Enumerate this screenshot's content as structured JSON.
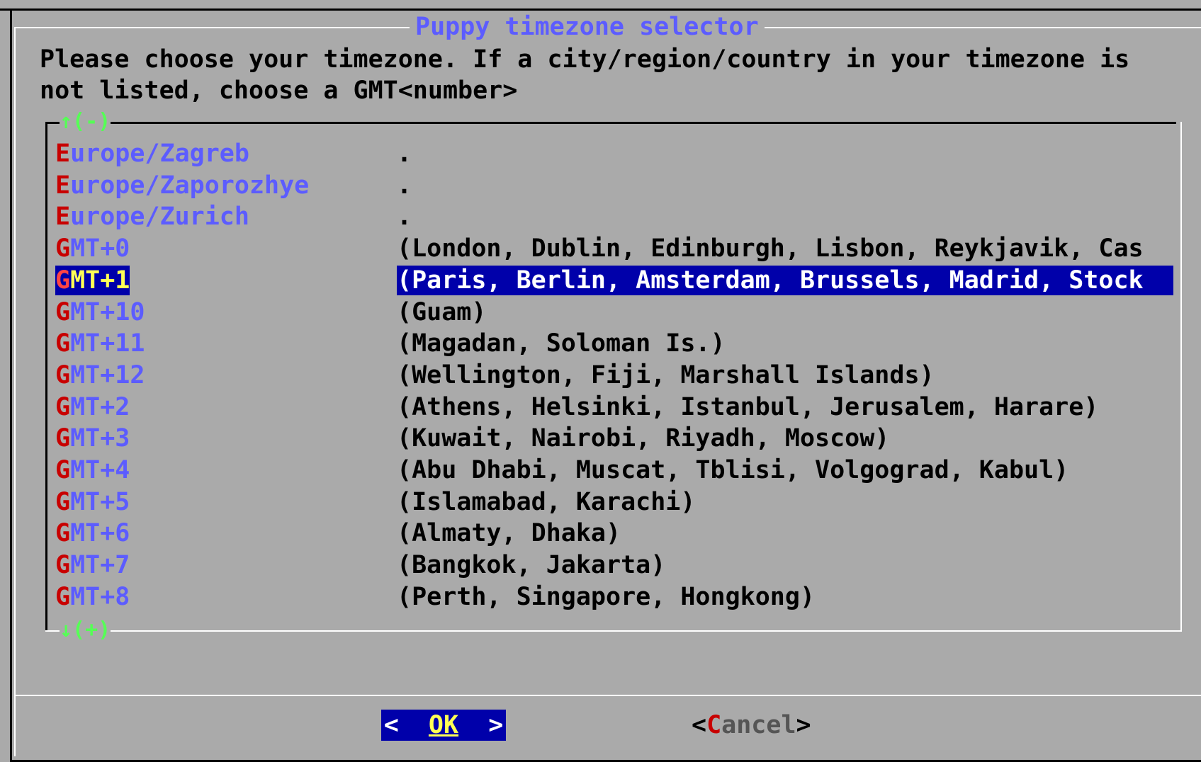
{
  "dialog": {
    "title": "Puppy timezone selector",
    "prompt_line1": "Please choose your timezone. If a city/region/country in your timezone is",
    "prompt_line2": "not listed, choose a GMT<number>"
  },
  "list": {
    "scroll_up_label": "↑(-)",
    "scroll_down_label": "↓(+)",
    "items": [
      {
        "hotkey": "E",
        "rest": "urope/Zagreb",
        "desc": "."
      },
      {
        "hotkey": "E",
        "rest": "urope/Zaporozhye",
        "desc": "."
      },
      {
        "hotkey": "E",
        "rest": "urope/Zurich",
        "desc": "."
      },
      {
        "hotkey": "G",
        "rest": "MT+0",
        "desc": "(London, Dublin, Edinburgh, Lisbon, Reykjavik, Cas"
      },
      {
        "hotkey": "G",
        "rest": "MT+1",
        "desc": "(Paris, Berlin, Amsterdam, Brussels, Madrid, Stock"
      },
      {
        "hotkey": "G",
        "rest": "MT+10",
        "desc": "(Guam)"
      },
      {
        "hotkey": "G",
        "rest": "MT+11",
        "desc": "(Magadan, Soloman Is.)"
      },
      {
        "hotkey": "G",
        "rest": "MT+12",
        "desc": "(Wellington, Fiji, Marshall Islands)"
      },
      {
        "hotkey": "G",
        "rest": "MT+2",
        "desc": "(Athens, Helsinki, Istanbul, Jerusalem, Harare)"
      },
      {
        "hotkey": "G",
        "rest": "MT+3",
        "desc": "(Kuwait, Nairobi, Riyadh, Moscow)"
      },
      {
        "hotkey": "G",
        "rest": "MT+4",
        "desc": "(Abu Dhabi, Muscat, Tblisi, Volgograd, Kabul)"
      },
      {
        "hotkey": "G",
        "rest": "MT+5",
        "desc": "(Islamabad, Karachi)"
      },
      {
        "hotkey": "G",
        "rest": "MT+6",
        "desc": "(Almaty, Dhaka)"
      },
      {
        "hotkey": "G",
        "rest": "MT+7",
        "desc": "(Bangkok, Jakarta)"
      },
      {
        "hotkey": "G",
        "rest": "MT+8",
        "desc": "(Perth, Singapore, Hongkong)"
      }
    ],
    "selected_index": 4
  },
  "buttons": {
    "ok_left": "<",
    "ok_label": "OK",
    "ok_right": ">",
    "cancel_open": "<",
    "cancel_hotkey": "C",
    "cancel_rest": "ancel",
    "cancel_close": ">"
  },
  "colors": {
    "background": "#aaaaaa",
    "selection": "#0000aa",
    "hotkey": "#c80000",
    "item_text": "#5c5cff",
    "scroll_arrows": "#55ff55"
  }
}
